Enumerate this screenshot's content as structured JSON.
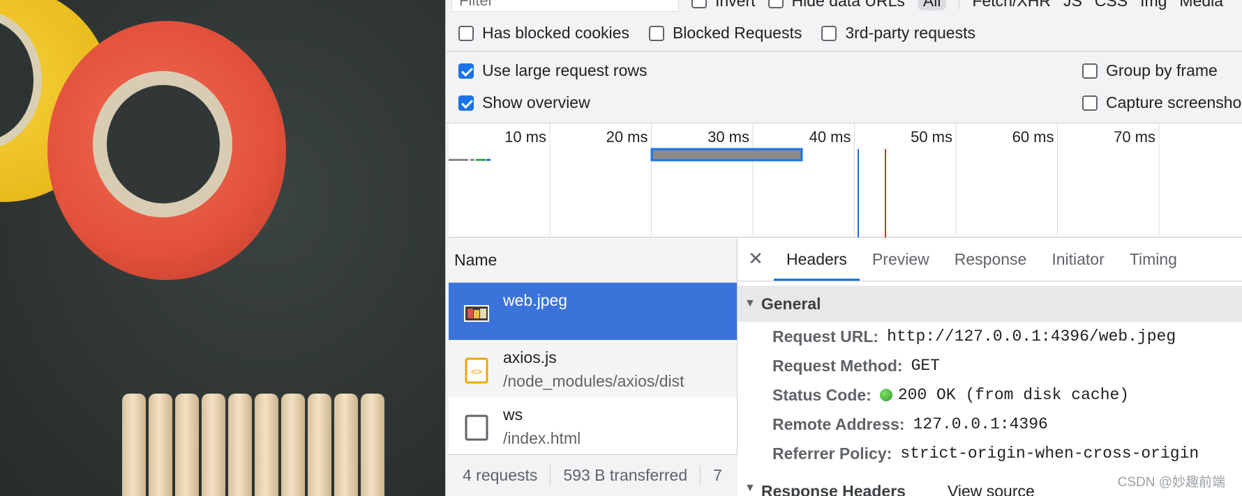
{
  "filter": {
    "placeholder": "Filter",
    "invert_label": "Invert",
    "hide_data_urls_label": "Hide data URLs",
    "types": [
      "All",
      "Fetch/XHR",
      "JS",
      "CSS",
      "Img",
      "Media"
    ]
  },
  "toolbar_row2": {
    "has_blocked_cookies": "Has blocked cookies",
    "blocked_requests": "Blocked Requests",
    "third_party": "3rd-party requests"
  },
  "settings": {
    "use_large_rows": "Use large request rows",
    "show_overview": "Show overview",
    "group_by_frame": "Group by frame",
    "capture_screenshots": "Capture screensho"
  },
  "overview": {
    "ticks": [
      "10 ms",
      "20 ms",
      "30 ms",
      "40 ms",
      "50 ms",
      "60 ms",
      "70 ms"
    ],
    "colors": {
      "bar": "#8a8a8a",
      "bar_border": "#1a73e8",
      "dom_line": "#1a73e8",
      "load_line": "#d93025"
    }
  },
  "request_list": {
    "header": "Name",
    "rows": [
      {
        "name": "web.jpeg",
        "path": "",
        "icon": "image-file-icon",
        "selected": true
      },
      {
        "name": "axios.js",
        "path": "/node_modules/axios/dist",
        "icon": "script-file-icon",
        "selected": false
      },
      {
        "name": "ws",
        "path": "/index.html",
        "icon": "document-file-icon",
        "selected": false
      }
    ],
    "status": {
      "requests": "4 requests",
      "transferred": "593 B transferred",
      "more": "7"
    }
  },
  "details": {
    "close_glyph": "✕",
    "tabs": [
      "Headers",
      "Preview",
      "Response",
      "Initiator",
      "Timing"
    ],
    "active_tab": "Headers",
    "general_title": "General",
    "general": [
      {
        "key": "Request URL:",
        "value": "http://127.0.0.1:4396/web.jpeg"
      },
      {
        "key": "Request Method:",
        "value": "GET"
      },
      {
        "key": "Status Code:",
        "value": "200 OK (from disk cache)",
        "status_dot": "#2e9e27"
      },
      {
        "key": "Remote Address:",
        "value": "127.0.0.1:4396"
      },
      {
        "key": "Referrer Policy:",
        "value": "strict-origin-when-cross-origin"
      }
    ],
    "response_headers_title": "Response Headers",
    "view_source": "View source"
  },
  "watermark": "CSDN @妙趣前端"
}
